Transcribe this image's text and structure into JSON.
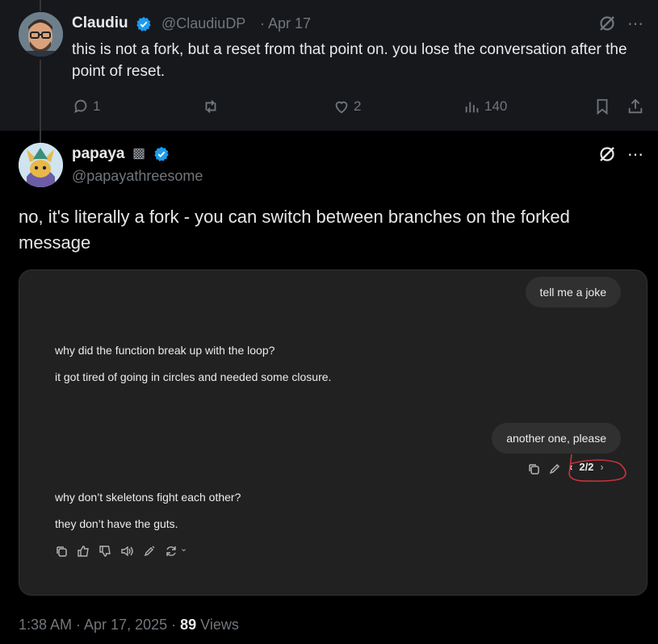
{
  "reply": {
    "author_name": "Claudiu",
    "author_handle": "@ClaudiuDP",
    "date": "· Apr 17",
    "text": "this is not a fork, but a reset from that point on. you lose the conversation after the point of reset.",
    "stats": {
      "replies": "1",
      "retweets": "",
      "likes": "2",
      "views": "140"
    }
  },
  "main": {
    "author_name": "papaya",
    "name_emoji": "▩",
    "author_handle": "@papayathreesome",
    "text": "no, it's literally a fork - you can switch between branches on the forked message"
  },
  "embed": {
    "user_msg_1": "tell me a joke",
    "ai_line_1": "why did the function break up with the loop?",
    "ai_line_2": "it got tired of going in circles and needed some closure.",
    "user_msg_2": "another one, please",
    "pager": "2/2",
    "ai_line_3": "why don’t skeletons fight each other?",
    "ai_line_4": "they don’t have the guts."
  },
  "footer": {
    "time": "1:38 AM · Apr 17, 2025 · ",
    "views_count": "89",
    "views_label": " Views"
  },
  "colors": {
    "verified": "#1d9bf0",
    "annotation": "#c8323c",
    "background": "#000000"
  }
}
